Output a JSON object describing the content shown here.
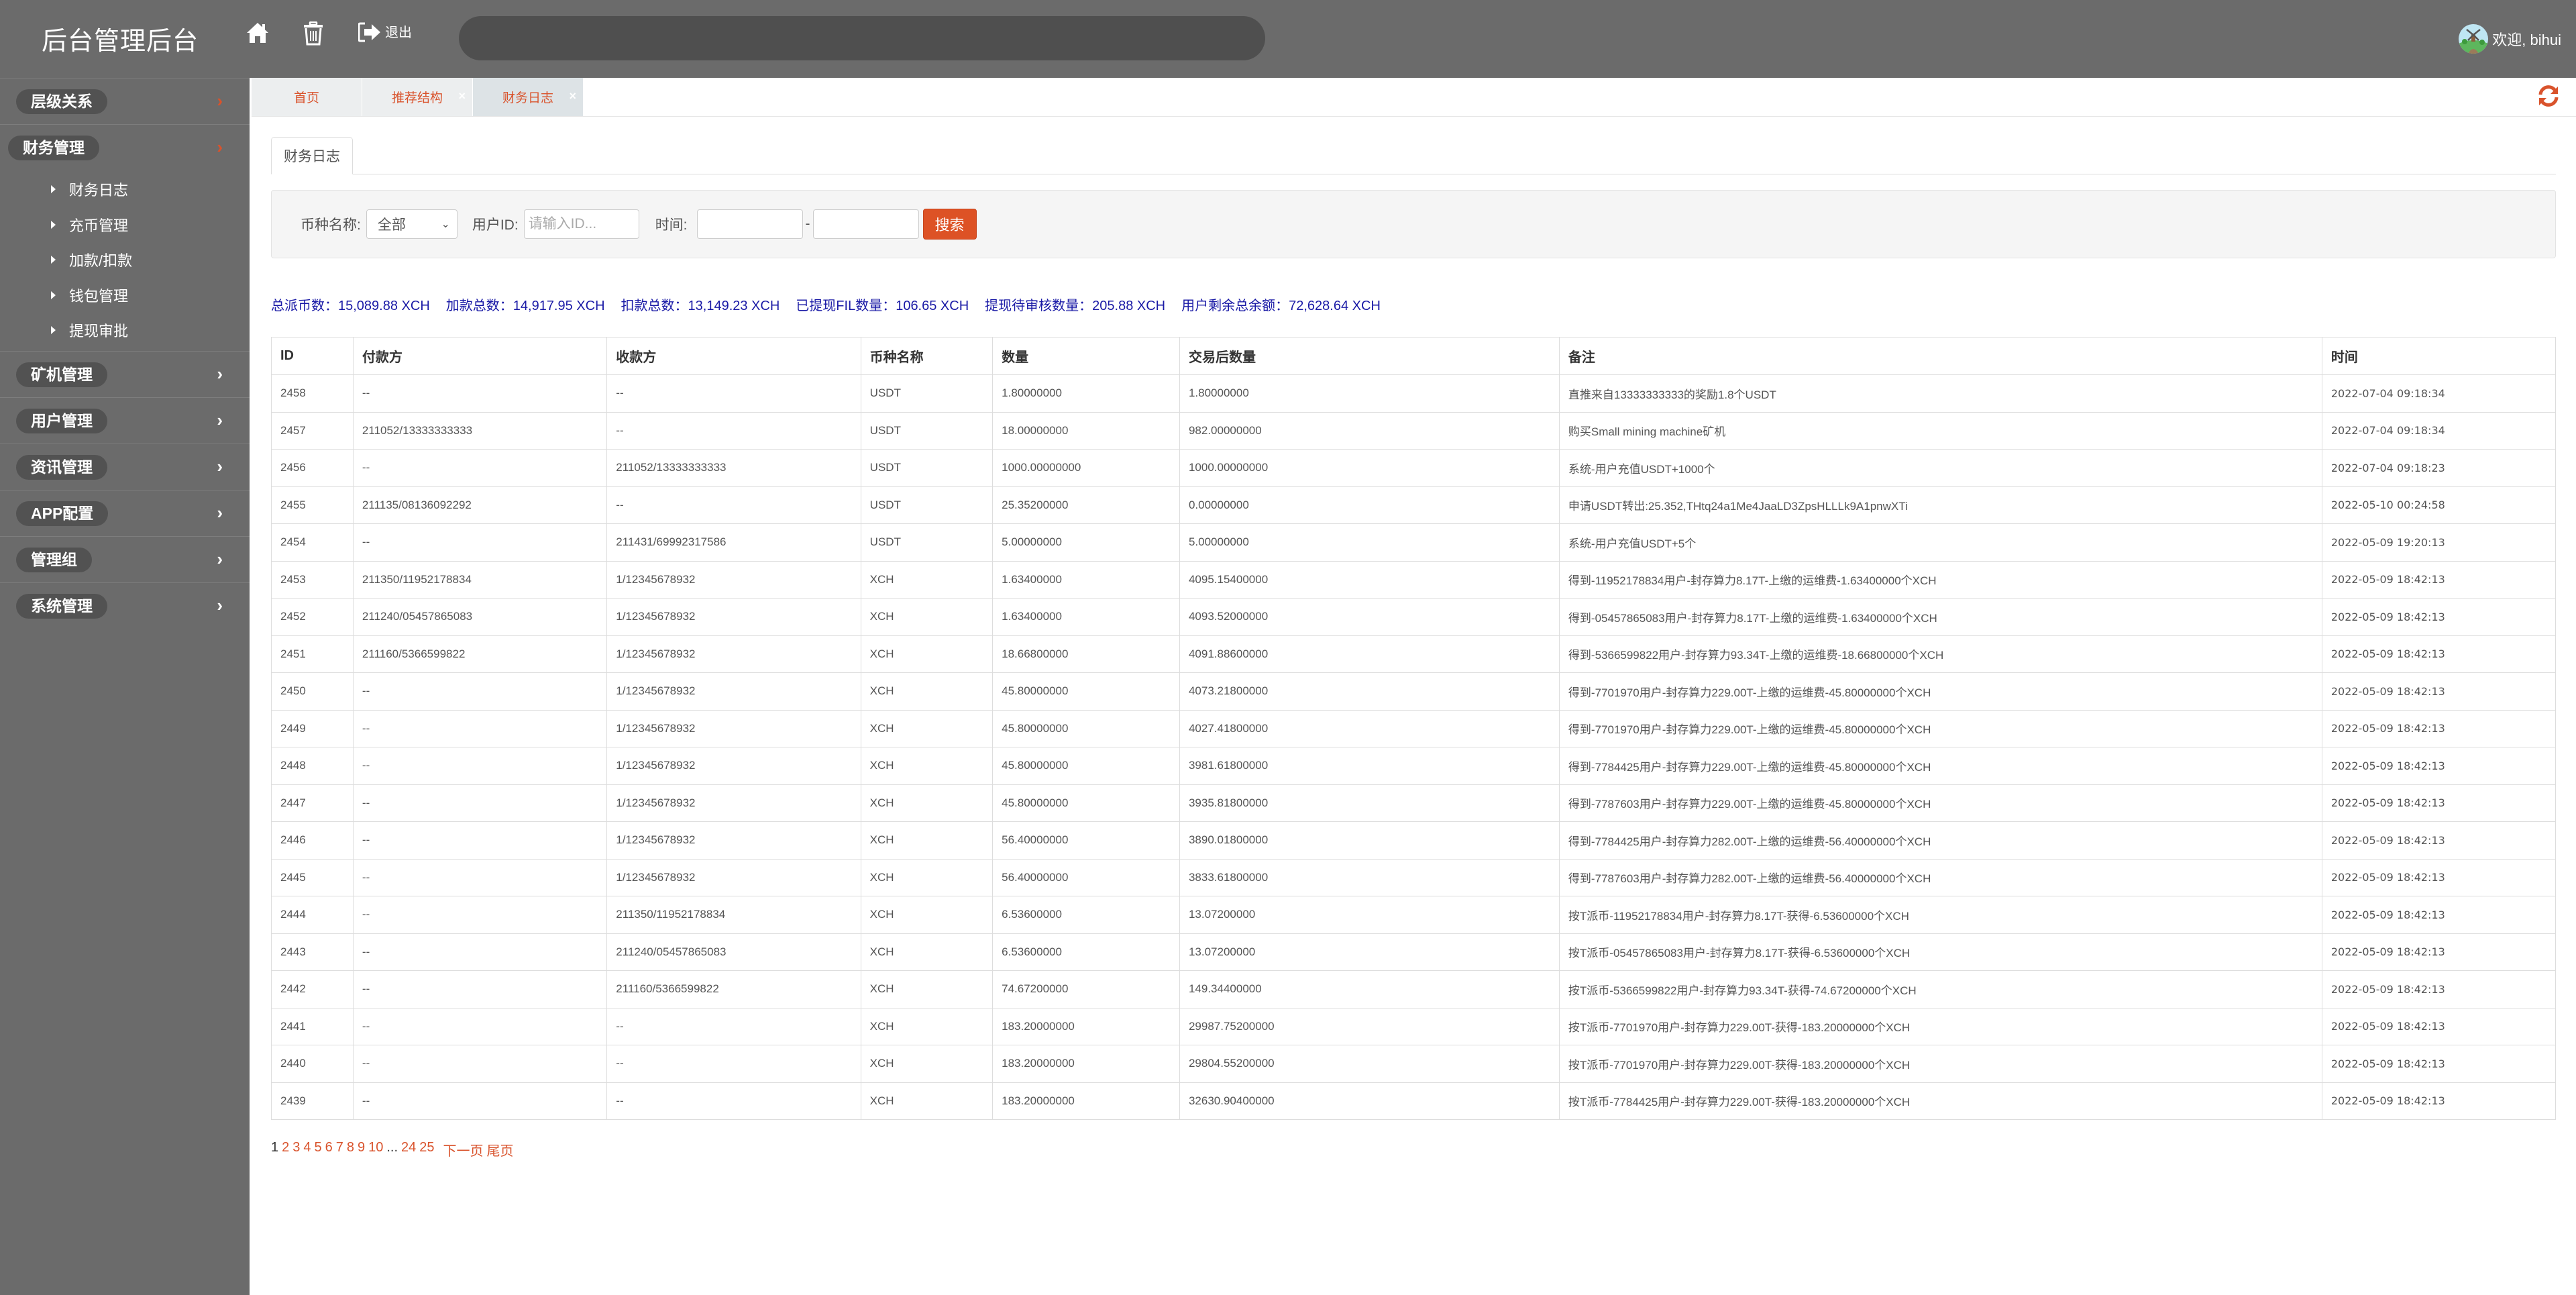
{
  "header": {
    "title": "后台管理后台",
    "logout_label": "退出",
    "search_value": "",
    "welcome": "欢迎, bihui"
  },
  "sidebar": {
    "groups": [
      {
        "label": "层级关系",
        "arrow_color": "red"
      },
      {
        "label": "财务管理",
        "arrow_color": "red",
        "expanded": true,
        "items": [
          {
            "label": "财务日志"
          },
          {
            "label": "充币管理"
          },
          {
            "label": "加款/扣款"
          },
          {
            "label": "钱包管理"
          },
          {
            "label": "提现审批"
          }
        ]
      },
      {
        "label": "矿机管理"
      },
      {
        "label": "用户管理"
      },
      {
        "label": "资讯管理"
      },
      {
        "label": "APP配置"
      },
      {
        "label": "管理组"
      },
      {
        "label": "系统管理"
      }
    ]
  },
  "tabs": [
    {
      "label": "首页",
      "closable": false
    },
    {
      "label": "推荐结构",
      "closable": true
    },
    {
      "label": "财务日志",
      "closable": true,
      "active": true
    }
  ],
  "page": {
    "tab_label": "财务日志",
    "filter": {
      "coin_label": "币种名称:",
      "coin_value": "全部",
      "user_label": "用户ID:",
      "user_placeholder": "请输入ID...",
      "user_value": "",
      "time_label": "时间:",
      "time_start": "",
      "time_sep": "-",
      "time_end": "",
      "search_button": "搜索"
    },
    "stats": [
      "总派币数：15,089.88 XCH",
      "加款总数：14,917.95 XCH",
      "扣款总数：13,149.23 XCH",
      "已提现FIL数量：106.65 XCH",
      "提现待审核数量：205.88 XCH",
      "用户剩余总余额：72,628.64 XCH"
    ],
    "table": {
      "columns": [
        "ID",
        "付款方",
        "收款方",
        "币种名称",
        "数量",
        "交易后数量",
        "备注",
        "时间"
      ],
      "rows": [
        [
          "2458",
          "--",
          "--",
          "USDT",
          "1.80000000",
          "1.80000000",
          "直推来自13333333333的奖励1.8个USDT",
          "2022-07-04 09:18:34"
        ],
        [
          "2457",
          "211052/13333333333",
          "--",
          "USDT",
          "18.00000000",
          "982.00000000",
          "购买Small mining machine矿机",
          "2022-07-04 09:18:34"
        ],
        [
          "2456",
          "--",
          "211052/13333333333",
          "USDT",
          "1000.00000000",
          "1000.00000000",
          "系统-用户充值USDT+1000个",
          "2022-07-04 09:18:23"
        ],
        [
          "2455",
          "211135/08136092292",
          "--",
          "USDT",
          "25.35200000",
          "0.00000000",
          "申请USDT转出:25.352,THtq24a1Me4JaaLD3ZpsHLLLk9A1pnwXTi",
          "2022-05-10 00:24:58"
        ],
        [
          "2454",
          "--",
          "211431/69992317586",
          "USDT",
          "5.00000000",
          "5.00000000",
          "系统-用户充值USDT+5个",
          "2022-05-09 19:20:13"
        ],
        [
          "2453",
          "211350/11952178834",
          "1/12345678932",
          "XCH",
          "1.63400000",
          "4095.15400000",
          "得到-11952178834用户-封存算力8.17T-上缴的运维费-1.63400000个XCH",
          "2022-05-09 18:42:13"
        ],
        [
          "2452",
          "211240/05457865083",
          "1/12345678932",
          "XCH",
          "1.63400000",
          "4093.52000000",
          "得到-05457865083用户-封存算力8.17T-上缴的运维费-1.63400000个XCH",
          "2022-05-09 18:42:13"
        ],
        [
          "2451",
          "211160/5366599822",
          "1/12345678932",
          "XCH",
          "18.66800000",
          "4091.88600000",
          "得到-5366599822用户-封存算力93.34T-上缴的运维费-18.66800000个XCH",
          "2022-05-09 18:42:13"
        ],
        [
          "2450",
          "--",
          "1/12345678932",
          "XCH",
          "45.80000000",
          "4073.21800000",
          "得到-7701970用户-封存算力229.00T-上缴的运维费-45.80000000个XCH",
          "2022-05-09 18:42:13"
        ],
        [
          "2449",
          "--",
          "1/12345678932",
          "XCH",
          "45.80000000",
          "4027.41800000",
          "得到-7701970用户-封存算力229.00T-上缴的运维费-45.80000000个XCH",
          "2022-05-09 18:42:13"
        ],
        [
          "2448",
          "--",
          "1/12345678932",
          "XCH",
          "45.80000000",
          "3981.61800000",
          "得到-7784425用户-封存算力229.00T-上缴的运维费-45.80000000个XCH",
          "2022-05-09 18:42:13"
        ],
        [
          "2447",
          "--",
          "1/12345678932",
          "XCH",
          "45.80000000",
          "3935.81800000",
          "得到-7787603用户-封存算力229.00T-上缴的运维费-45.80000000个XCH",
          "2022-05-09 18:42:13"
        ],
        [
          "2446",
          "--",
          "1/12345678932",
          "XCH",
          "56.40000000",
          "3890.01800000",
          "得到-7784425用户-封存算力282.00T-上缴的运维费-56.40000000个XCH",
          "2022-05-09 18:42:13"
        ],
        [
          "2445",
          "--",
          "1/12345678932",
          "XCH",
          "56.40000000",
          "3833.61800000",
          "得到-7787603用户-封存算力282.00T-上缴的运维费-56.40000000个XCH",
          "2022-05-09 18:42:13"
        ],
        [
          "2444",
          "--",
          "211350/11952178834",
          "XCH",
          "6.53600000",
          "13.07200000",
          "按T派币-11952178834用户-封存算力8.17T-获得-6.53600000个XCH",
          "2022-05-09 18:42:13"
        ],
        [
          "2443",
          "--",
          "211240/05457865083",
          "XCH",
          "6.53600000",
          "13.07200000",
          "按T派币-05457865083用户-封存算力8.17T-获得-6.53600000个XCH",
          "2022-05-09 18:42:13"
        ],
        [
          "2442",
          "--",
          "211160/5366599822",
          "XCH",
          "74.67200000",
          "149.34400000",
          "按T派币-5366599822用户-封存算力93.34T-获得-74.67200000个XCH",
          "2022-05-09 18:42:13"
        ],
        [
          "2441",
          "--",
          "--",
          "XCH",
          "183.20000000",
          "29987.75200000",
          "按T派币-7701970用户-封存算力229.00T-获得-183.20000000个XCH",
          "2022-05-09 18:42:13"
        ],
        [
          "2440",
          "--",
          "--",
          "XCH",
          "183.20000000",
          "29804.55200000",
          "按T派币-7701970用户-封存算力229.00T-获得-183.20000000个XCH",
          "2022-05-09 18:42:13"
        ],
        [
          "2439",
          "--",
          "--",
          "XCH",
          "183.20000000",
          "32630.90400000",
          "按T派币-7784425用户-封存算力229.00T-获得-183.20000000个XCH",
          "2022-05-09 18:42:13"
        ]
      ]
    },
    "pagination": {
      "current": "1",
      "pages": [
        "2",
        "3",
        "4",
        "5",
        "6",
        "7",
        "8",
        "9",
        "10"
      ],
      "ellipsis": "...",
      "tail_pages": [
        "24",
        "25"
      ],
      "next_label": "下一页",
      "last_label": "尾页"
    }
  },
  "colors": {
    "header_bg": "#6b6b6b",
    "accent": "#d9532c",
    "stats_text": "#1a1aa6",
    "search_button": "#dd5225"
  }
}
